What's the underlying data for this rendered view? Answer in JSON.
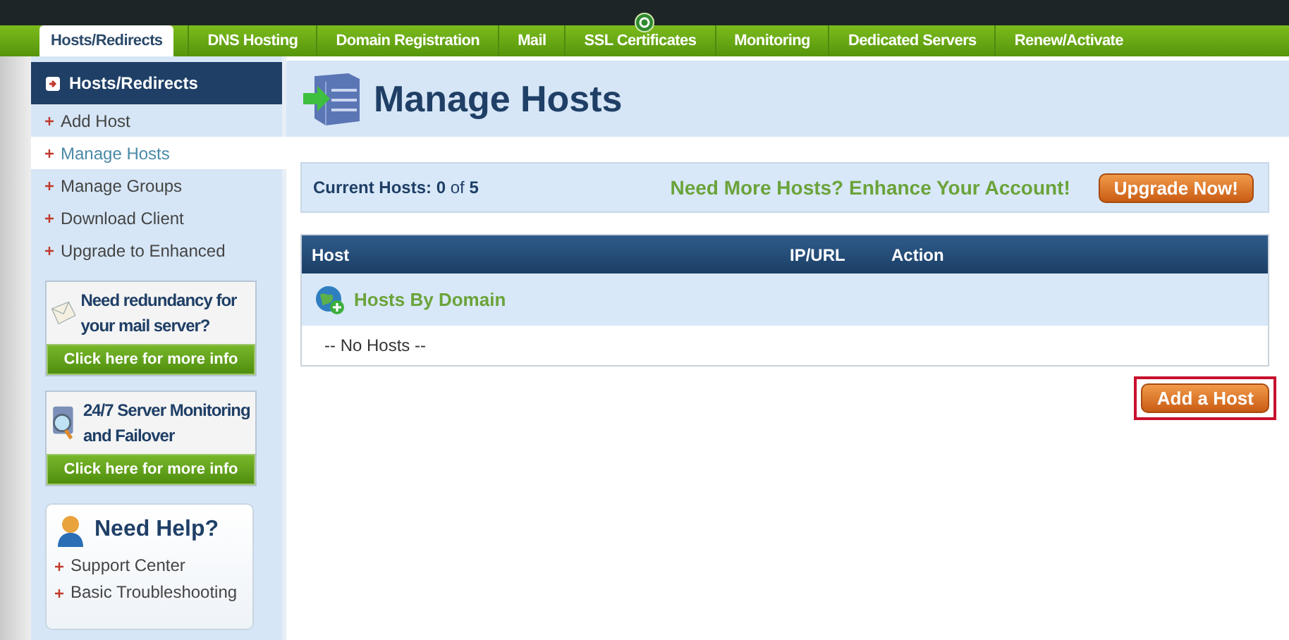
{
  "nav_tabs": [
    {
      "label": "Hosts/Redirects",
      "selected": true
    },
    {
      "label": "DNS Hosting",
      "selected": false
    },
    {
      "label": "Domain Registration",
      "selected": false
    },
    {
      "label": "Mail",
      "selected": false
    },
    {
      "label": "SSL Certificates",
      "selected": false
    },
    {
      "label": "Monitoring",
      "selected": false
    },
    {
      "label": "Dedicated Servers",
      "selected": false
    },
    {
      "label": "Renew/Activate",
      "selected": false
    }
  ],
  "sidebar": {
    "title": "Hosts/Redirects",
    "items": [
      {
        "label": "Add Host",
        "selected": false
      },
      {
        "label": "Manage Hosts",
        "selected": true
      },
      {
        "label": "Manage Groups",
        "selected": false
      },
      {
        "label": "Download Client",
        "selected": false
      },
      {
        "label": "Upgrade to Enhanced",
        "selected": false
      }
    ],
    "promos": [
      {
        "kind": "mail",
        "text": "Need redundancy for your mail server?",
        "button": "Click here for more info"
      },
      {
        "kind": "monitoring",
        "text": "24/7 Server Monitoring and Failover",
        "button": "Click here for more info"
      }
    ],
    "help": {
      "title": "Need Help?",
      "links": [
        "Support Center",
        "Basic Troubleshooting"
      ]
    }
  },
  "page_title": "Manage Hosts",
  "summary": {
    "current_hosts": "**Current Hosts: 0** of **5**",
    "promo": "Need More Hosts? Enhance Your Account!",
    "button": "Upgrade Now!"
  },
  "table": {
    "columns": [
      "Host",
      "IP/URL",
      "Action"
    ],
    "group": "Hosts By Domain",
    "empty": "-- No Hosts --"
  },
  "add_button": {
    "label": "Add a Host",
    "highlighted": true
  }
}
